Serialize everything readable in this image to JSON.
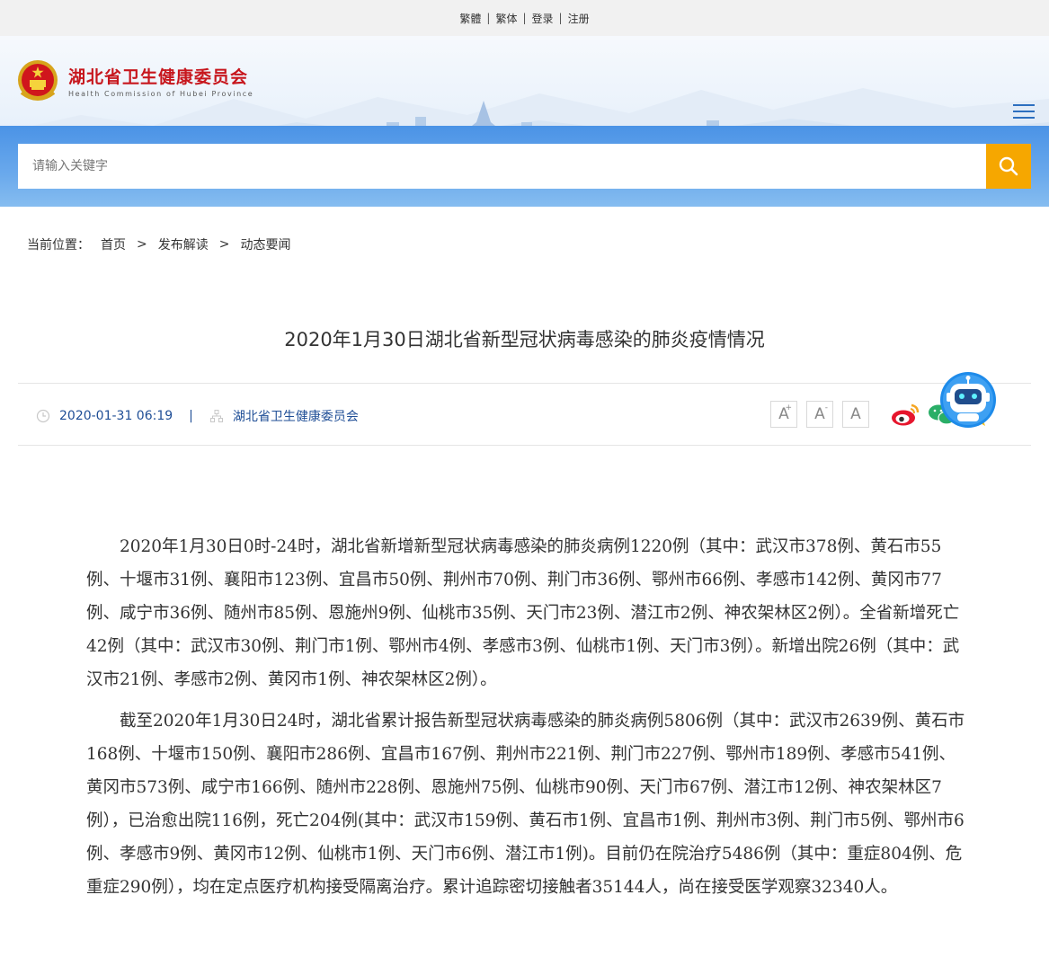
{
  "topbar": {
    "links": [
      "繁體",
      "繁体",
      "登录",
      "注册"
    ]
  },
  "header": {
    "site_name_cn": "湖北省卫生健康委员会",
    "site_name_en": "Health Commission of Hubei Province",
    "brand_color": "#c7161d",
    "menu_icon": "hamburger-icon"
  },
  "search": {
    "placeholder": "请输入关键字",
    "button_icon": "search-icon",
    "button_color": "#f6a700"
  },
  "breadcrumb": {
    "lead": "当前位置：",
    "items": [
      "首页",
      "发布解读",
      "动态要闻"
    ],
    "separator": ">"
  },
  "article": {
    "title": "2020年1月30日湖北省新型冠状病毒感染的肺炎疫情情况",
    "date": "2020-01-31 06:19",
    "separator": "|",
    "source": "湖北省卫生健康委员会",
    "font_size_buttons": [
      "A",
      "A",
      "A"
    ],
    "share_icons": [
      "weibo-icon",
      "wechat-icon",
      "qzone-icon"
    ],
    "paragraphs": [
      "2020年1月30日0时-24时，湖北省新增新型冠状病毒感染的肺炎病例1220例（其中：武汉市378例、黄石市55例、十堰市31例、襄阳市123例、宜昌市50例、荆州市70例、荆门市36例、鄂州市66例、孝感市142例、黄冈市77例、咸宁市36例、随州市85例、恩施州9例、仙桃市35例、天门市23例、潜江市2例、神农架林区2例）。全省新增死亡42例（其中：武汉市30例、荆门市1例、鄂州市4例、孝感市3例、仙桃市1例、天门市3例）。新增出院26例（其中：武汉市21例、孝感市2例、黄冈市1例、神农架林区2例）。",
      "截至2020年1月30日24时，湖北省累计报告新型冠状病毒感染的肺炎病例5806例（其中：武汉市2639例、黄石市168例、十堰市150例、襄阳市286例、宜昌市167例、荆州市221例、荆门市227例、鄂州市189例、孝感市541例、黄冈市573例、咸宁市166例、随州市228例、恩施州75例、仙桃市90例、天门市67例、潜江市12例、神农架林区7例），已治愈出院116例，死亡204例(其中：武汉市159例、黄石市1例、宜昌市1例、荆州市3例、荆门市5例、鄂州市6例、孝感市9例、黄冈市12例、仙桃市1例、天门市6例、潜江市1例)。目前仍在院治疗5486例（其中：重症804例、危重症290例），均在定点医疗机构接受隔离治疗。累计追踪密切接触者35144人，尚在接受医学观察32340人。"
    ]
  },
  "assistant": {
    "icon": "robot-assistant-icon"
  }
}
